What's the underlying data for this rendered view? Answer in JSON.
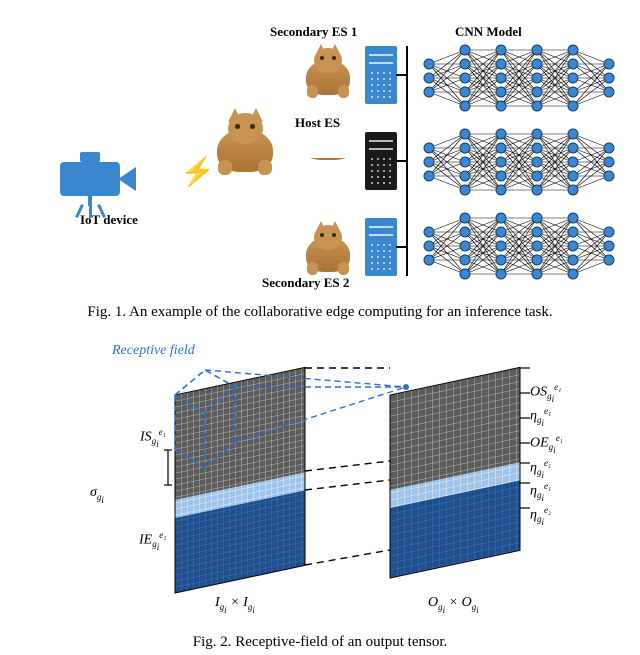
{
  "fig1": {
    "labels": {
      "iot": "IoT device",
      "secondary1": "Secondary ES 1",
      "host": "Host ES",
      "secondary2": "Secondary ES 2",
      "cnn": "CNN Model"
    },
    "caption": "Fig. 1.   An example of the collaborative edge computing for an inference task."
  },
  "fig2": {
    "rf_label": "Receptive field",
    "labels": {
      "IS": "IS",
      "sigma": "σ",
      "IE": "IE",
      "OS": "OS",
      "eta_e1_a": "η",
      "OE": "OE",
      "eta_e1_b": "η",
      "eta_e1_c": "η",
      "eta_e2": "η",
      "Idim": "I",
      "Odim": "O",
      "sub_g": "g",
      "sub_i": "i",
      "sup_e1": "e₁",
      "sup_e2": "e₂",
      "times": "×"
    },
    "caption": "Fig. 2.   Receptive-field of an output tensor."
  }
}
